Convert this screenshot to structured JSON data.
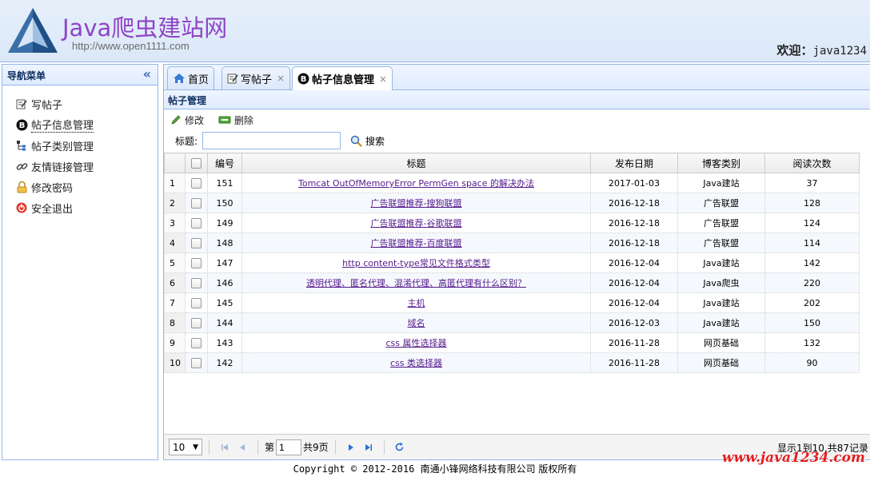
{
  "header": {
    "title": "Java爬虫建站网",
    "url": "http://www.open1111.com",
    "welcome_label": "欢迎：",
    "username": "java1234"
  },
  "sidebar": {
    "title": "导航菜单",
    "collapse_icon": "«",
    "items": [
      {
        "label": "写帖子",
        "icon": "edit-icon"
      },
      {
        "label": "帖子信息管理",
        "icon": "blog-icon"
      },
      {
        "label": "帖子类别管理",
        "icon": "category-icon"
      },
      {
        "label": "友情链接管理",
        "icon": "link-icon"
      },
      {
        "label": "修改密码",
        "icon": "lock-icon"
      },
      {
        "label": "安全退出",
        "icon": "exit-icon"
      }
    ]
  },
  "tabs": [
    {
      "label": "首页",
      "icon": "home-icon",
      "closable": false
    },
    {
      "label": "写帖子",
      "icon": "edit-icon",
      "closable": true
    },
    {
      "label": "帖子信息管理",
      "icon": "blog-icon",
      "closable": true
    }
  ],
  "tab_close": "×",
  "panel": {
    "title": "帖子管理",
    "edit_label": "修改",
    "delete_label": "删除",
    "search_label": "标题:",
    "search_value": "",
    "search_button": "搜索"
  },
  "grid": {
    "columns": [
      "",
      "",
      "编号",
      "标题",
      "发布日期",
      "博客类别",
      "阅读次数"
    ],
    "rows": [
      {
        "n": "1",
        "id": "151",
        "title": "Tomcat OutOfMemoryError PermGen space 的解决办法",
        "date": "2017-01-03",
        "type": "Java建站",
        "views": "37"
      },
      {
        "n": "2",
        "id": "150",
        "title": "广告联盟推荐-搜狗联盟",
        "date": "2016-12-18",
        "type": "广告联盟",
        "views": "128"
      },
      {
        "n": "3",
        "id": "149",
        "title": "广告联盟推荐-谷歌联盟",
        "date": "2016-12-18",
        "type": "广告联盟",
        "views": "124"
      },
      {
        "n": "4",
        "id": "148",
        "title": "广告联盟推荐-百度联盟",
        "date": "2016-12-18",
        "type": "广告联盟",
        "views": "114"
      },
      {
        "n": "5",
        "id": "147",
        "title": "http content-type常见文件格式类型",
        "date": "2016-12-04",
        "type": "Java建站",
        "views": "142"
      },
      {
        "n": "6",
        "id": "146",
        "title": "透明代理、匿名代理、混淆代理、高匿代理有什么区别？",
        "date": "2016-12-04",
        "type": "Java爬虫",
        "views": "220"
      },
      {
        "n": "7",
        "id": "145",
        "title": "主机",
        "date": "2016-12-04",
        "type": "Java建站",
        "views": "202"
      },
      {
        "n": "8",
        "id": "144",
        "title": "域名",
        "date": "2016-12-03",
        "type": "Java建站",
        "views": "150"
      },
      {
        "n": "9",
        "id": "143",
        "title": "css 属性选择器",
        "date": "2016-11-28",
        "type": "网页基础",
        "views": "132"
      },
      {
        "n": "10",
        "id": "142",
        "title": "css 类选择器",
        "date": "2016-11-28",
        "type": "网页基础",
        "views": "90"
      }
    ]
  },
  "pager": {
    "page_size": "10",
    "page_prefix": "第",
    "page_value": "1",
    "page_suffix": "共9页",
    "info": "显示1到10,共87记录"
  },
  "footer": {
    "prefix": "Copyright © 2012-2016 ",
    "company": "南通小锋网络科技有限公司 版权所有"
  },
  "watermark": "www.java1234.com",
  "colors": {
    "brand_purple": "#8f44c6",
    "border_blue": "#95b8e7",
    "link": "#551a8b",
    "watermark_red": "#e61e1e"
  }
}
